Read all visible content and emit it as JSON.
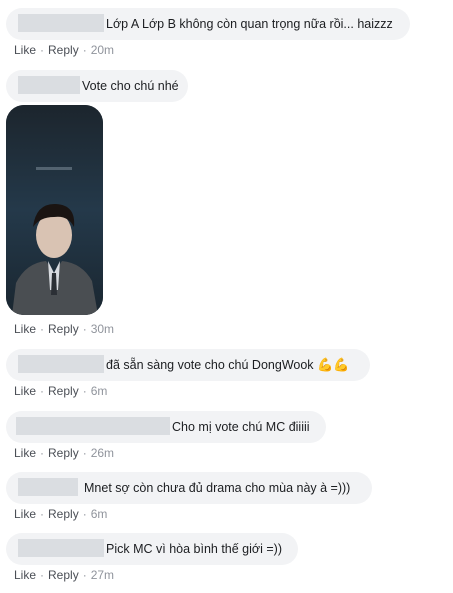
{
  "comments": [
    {
      "text": "Lớp A Lớp B không còn quan trọng nữa rồi... haizzz",
      "actions": {
        "like": "Like",
        "reply": "Reply",
        "time": "20m"
      }
    },
    {
      "text": "Vote cho chú nhé",
      "actions": {
        "like": "Like",
        "reply": "Reply",
        "time": "30m"
      }
    },
    {
      "text": "đã sẵn sàng vote cho chú DongWook",
      "emoji": "💪💪",
      "actions": {
        "like": "Like",
        "reply": "Reply",
        "time": "6m"
      }
    },
    {
      "text": "Cho mị vote chú MC điiiii",
      "actions": {
        "like": "Like",
        "reply": "Reply",
        "time": "26m"
      }
    },
    {
      "text": "Mnet sợ còn chưa đủ drama cho mùa này à =)))",
      "actions": {
        "like": "Like",
        "reply": "Reply",
        "time": "6m"
      }
    },
    {
      "text": "Pick MC vì hòa bình thế giới =))",
      "actions": {
        "like": "Like",
        "reply": "Reply",
        "time": "27m"
      }
    }
  ],
  "separator": "·",
  "colors": {
    "bubble": "#f2f3f5",
    "redaction": "#dadde1",
    "text": "#1c1e21",
    "action": "#4b4f56",
    "time": "#90949c"
  }
}
